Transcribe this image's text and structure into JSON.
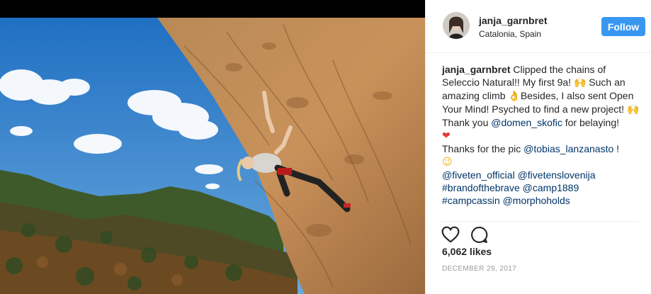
{
  "post": {
    "username": "janja_garnbret",
    "location": "Catalonia, Spain",
    "follow_label": "Follow",
    "caption": {
      "user": "janja_garnbret",
      "line1": "Clipped the chains of Seleccio Natural!! My first 9a!",
      "hands1": "🙌",
      "line2": "Such an amazing climb",
      "thumbs": "👌",
      "line3": "Besides, I also sent Open Your Mind! Psyched to find a new project!",
      "hands2": "🙌",
      "thanks_prefix": "Thank you",
      "mention_domen": "@domen_skofic",
      "thanks_suffix": "for belaying!",
      "heart": "❤",
      "pic_prefix": "Thanks for the pic",
      "mention_tobias": "@tobias_lanzanasto",
      "pic_suffix": "!",
      "wink": "😉",
      "mention_fiveten": "@fiveten_official",
      "mention_fivetens": "@fivetenslovenija",
      "tag_brand": "#brandofthebrave",
      "mention_camp": "@camp1889",
      "tag_campcassin": "#campcassin",
      "mention_morpho": "@morphoholds"
    },
    "likes": "6,062 likes",
    "date": "DECEMBER 29, 2017"
  },
  "icons": {
    "like": "heart-outline-icon",
    "comment": "comment-bubble-icon"
  },
  "colors": {
    "follow_bg": "#3897f0",
    "mention": "#003569",
    "text": "#262626",
    "muted": "#999999"
  }
}
